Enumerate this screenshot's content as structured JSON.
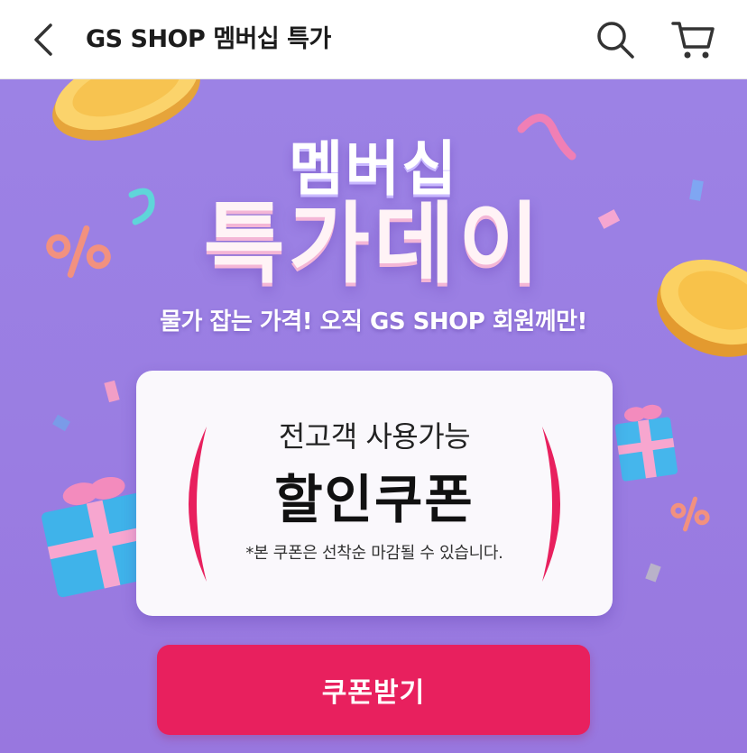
{
  "header": {
    "title": "GS SHOP 멤버십 특가",
    "back_icon": "chevron-left-icon",
    "search_icon": "search-icon",
    "cart_icon": "cart-icon"
  },
  "banner": {
    "headline_line1": "멤버십",
    "headline_line2": "특가데이",
    "subcopy": "물가 잡는 가격! 오직 GS SHOP 회원께만!",
    "background_color": "#9c82e5"
  },
  "coupon": {
    "line1": "전고객 사용가능",
    "line2": "할인쿠폰",
    "note": "*본 쿠폰은 선착순 마감될 수 있습니다.",
    "accent_color": "#e8205e"
  },
  "cta": {
    "label": "쿠폰받기",
    "color": "#e8205e"
  }
}
